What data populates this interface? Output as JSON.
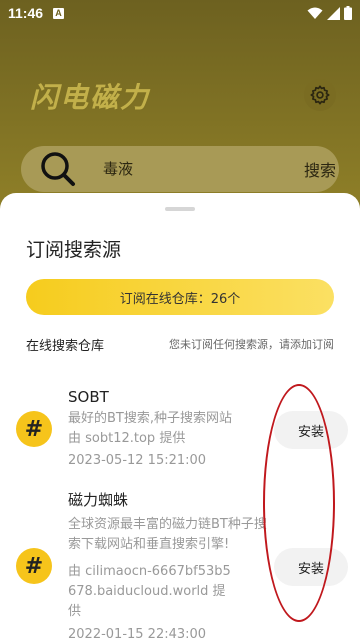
{
  "status_bar": {
    "time": "11:46",
    "notification_icon_letter": "A"
  },
  "app": {
    "title": "闪电磁力"
  },
  "search": {
    "query": "毒液",
    "button_label": "搜索"
  },
  "sheet": {
    "title": "订阅搜索源",
    "repo_pill": "订阅在线仓库：26个",
    "section_title": "在线搜索仓库",
    "section_hint": "您未订阅任何搜索源，请添加订阅"
  },
  "sources": [
    {
      "icon": "#",
      "name": "SOBT",
      "description": "最好的BT搜索,种子搜索网站",
      "provider": "由 sobt12.top 提供",
      "date": "2023-05-12 15:21:00",
      "install_label": "安装"
    },
    {
      "icon": "#",
      "name": "磁力蜘蛛",
      "description": "全球资源最丰富的磁力链BT种子搜索下载网站和垂直搜索引擎!",
      "provider": "由 cilimaocn-6667bf53b5678.baiducloud.world 提供",
      "date": "2022-01-15 22:43:00",
      "install_label": "安装"
    }
  ],
  "colors": {
    "accent": "#f6c41b",
    "annotation": "#c0181d",
    "text_muted": "#999999"
  }
}
